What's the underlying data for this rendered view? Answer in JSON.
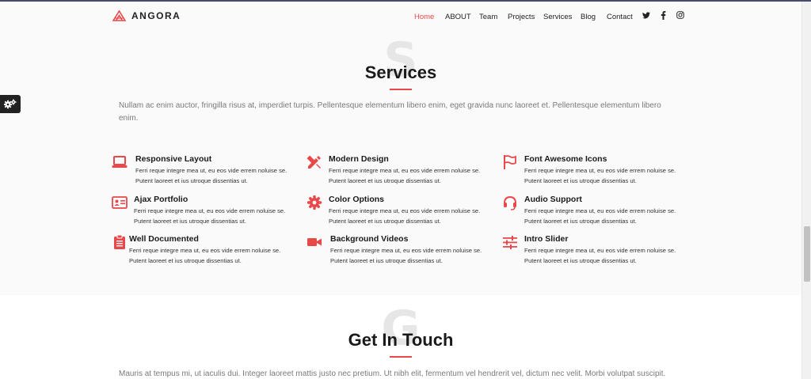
{
  "brand": {
    "name": "ANGORA",
    "accent": "#e8484a"
  },
  "nav": {
    "items": [
      {
        "label": "Home",
        "active": true
      },
      {
        "label": "ABOUT"
      },
      {
        "label": "Team"
      },
      {
        "label": "Projects"
      },
      {
        "label": "Services"
      },
      {
        "label": "Blog"
      },
      {
        "label": "Contact"
      }
    ],
    "social": [
      "twitter-icon",
      "facebook-icon",
      "instagram-icon"
    ]
  },
  "services": {
    "ghost_letter": "S",
    "title": "Services",
    "description": "Nullam ac enim auctor, fringilla risus at, imperdiet turpis. Pellentesque elementum libero enim, eget gravida nunc laoreet et. Pellentesque elementum libero enim.",
    "items": [
      {
        "title": "Responsive Layout",
        "icon": "laptop-icon",
        "text": "Ferri reque integre mea ut, eu eos vide errem noluise se. Putent laoreet et ius utroque dissentias ut."
      },
      {
        "title": "Modern Design",
        "icon": "pencil-ruler-icon",
        "text": "Ferri reque integre mea ut, eu eos vide errem noluise se. Putent laoreet et ius utroque dissentias ut."
      },
      {
        "title": "Font Awesome Icons",
        "icon": "flag-icon",
        "text": "Ferri reque integre mea ut, eu eos vide errem noluise se. Putent laoreet et ius utroque dissentias ut."
      },
      {
        "title": "Ajax Portfolio",
        "icon": "id-card-icon",
        "text": "Ferri reque integre mea ut, eu eos vide errem noluise se. Putent laoreet et ius utroque dissentias ut."
      },
      {
        "title": "Color Options",
        "icon": "gear-icon",
        "text": "Ferri reque integre mea ut, eu eos vide errem noluise se. Putent laoreet et ius utroque dissentias ut."
      },
      {
        "title": "Audio Support",
        "icon": "headset-icon",
        "text": "Ferri reque integre mea ut, eu eos vide errem noluise se. Putent laoreet et ius utroque dissentias ut."
      },
      {
        "title": "Well Documented",
        "icon": "clipboard-icon",
        "text": "Ferri reque integre mea ut, eu eos vide errem noluise se. Putent laoreet et ius utroque dissentias ut."
      },
      {
        "title": "Background Videos",
        "icon": "video-camera-icon",
        "text": "Ferri reque integre mea ut, eu eos vide errem noluise se. Putent laoreet et ius utroque dissentias ut."
      },
      {
        "title": "Intro Slider",
        "icon": "sliders-icon",
        "text": "Ferri reque integre mea ut, eu eos vide errem noluise se. Putent laoreet et ius utroque dissentias ut."
      }
    ]
  },
  "contact": {
    "ghost_letter": "G",
    "title": "Get In Touch",
    "description": "Mauris at tempus mi, ut iaculis dui. Integer laoreet mattis justo nec pretium. Ut nibh elit, fermentum vel hendrerit vel, dictum nec velit. Morbi volutpat suscipit."
  },
  "settings": {
    "icon": "gears-icon"
  }
}
